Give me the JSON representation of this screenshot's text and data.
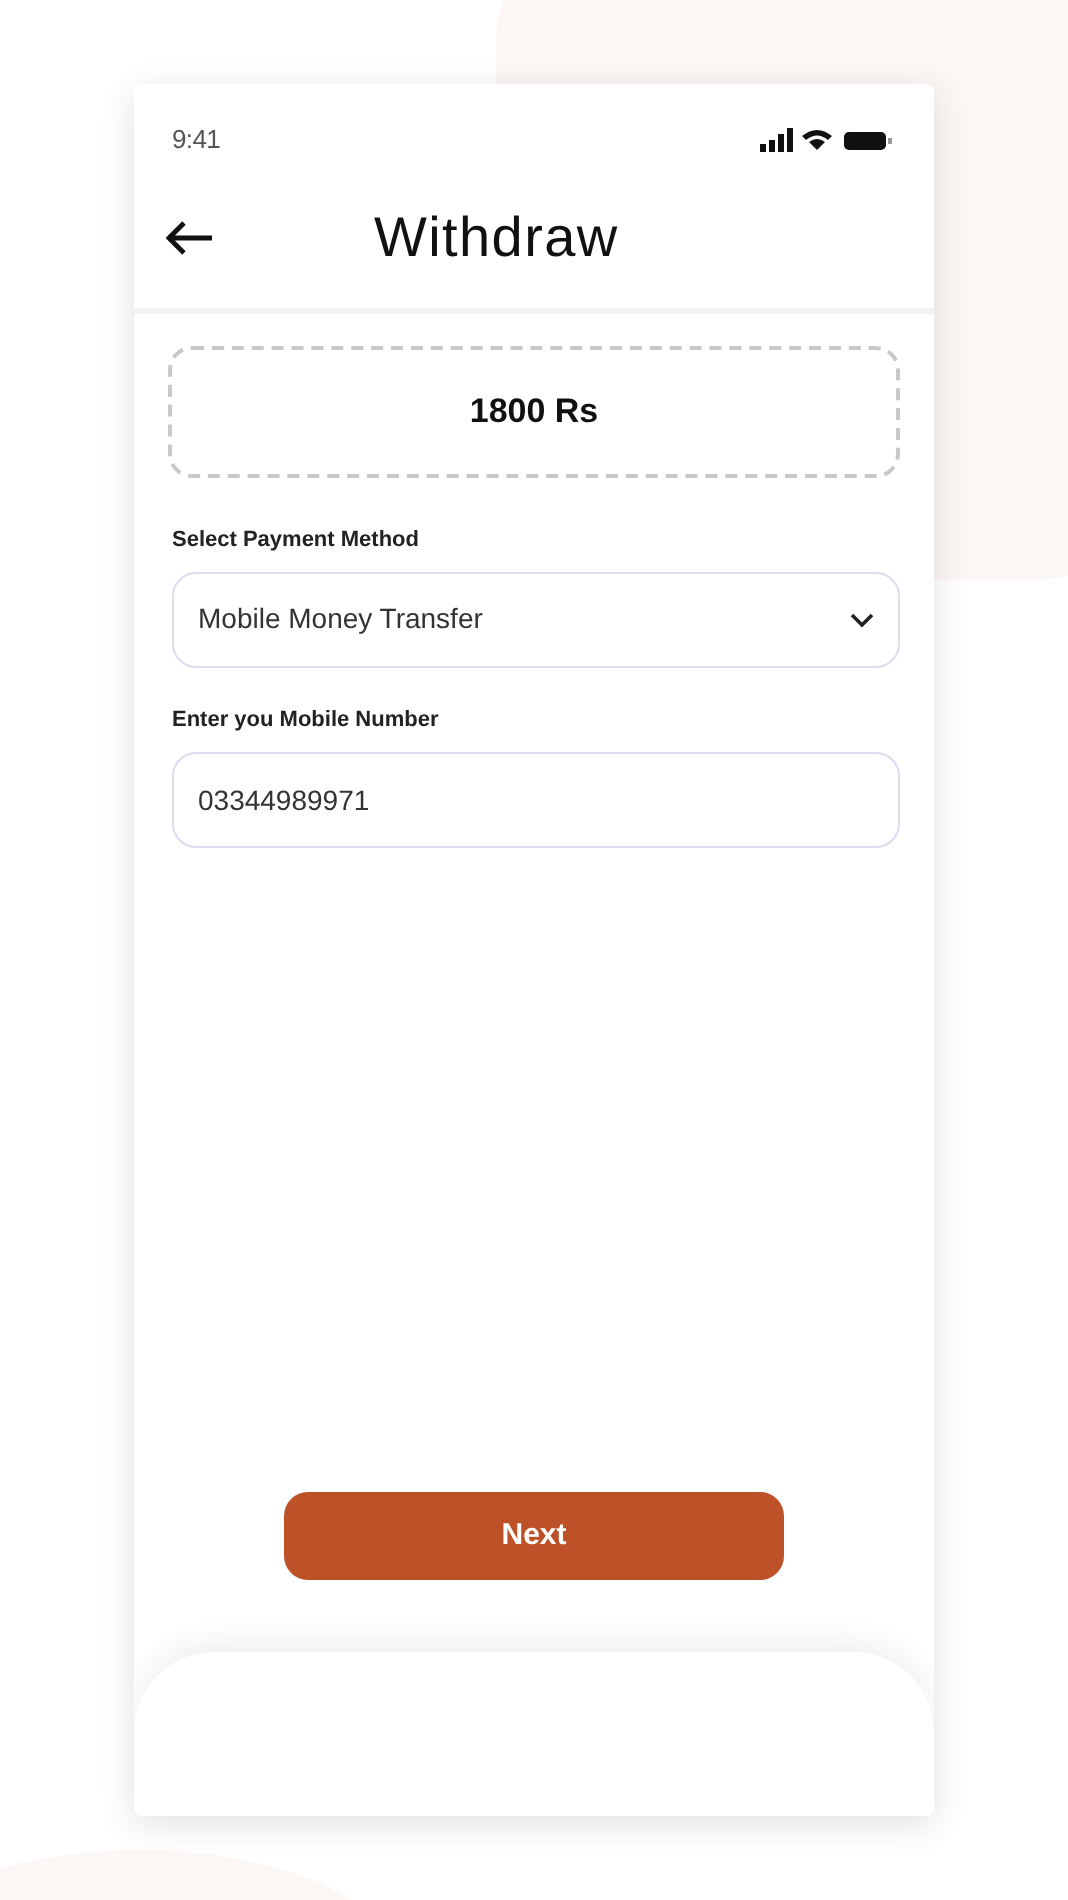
{
  "status_bar": {
    "time": "9:41"
  },
  "header": {
    "title": "Withdraw"
  },
  "amount": "1800 Rs",
  "payment_method": {
    "label": "Select Payment Method",
    "value": "Mobile Money Transfer"
  },
  "mobile_number": {
    "label": "Enter you Mobile Number",
    "value": "03344989971"
  },
  "next_button": "Next"
}
